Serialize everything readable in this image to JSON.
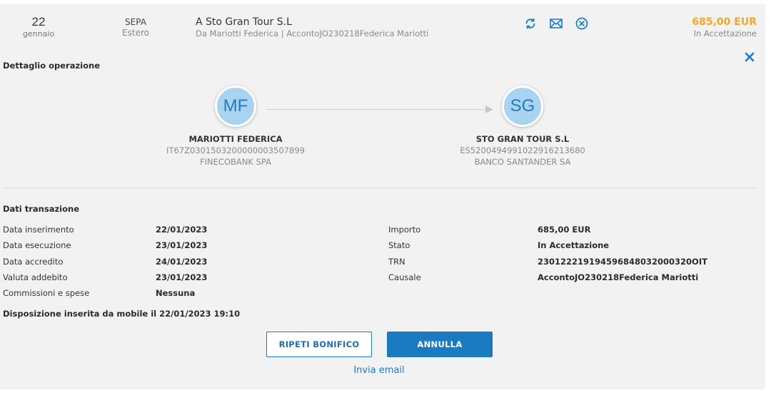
{
  "summary": {
    "day": "22",
    "month": "gennaio",
    "type_line1": "SEPA",
    "type_line2": "Estero",
    "title": "A Sto Gran Tour S.L",
    "subtitle": "Da Mariotti Federica | AccontoJO230218Federica Mariotti",
    "amount": "685,00 EUR",
    "amount_status": "In Accettazione",
    "actions": [
      {
        "icon": "repeat-icon"
      },
      {
        "icon": "mail-icon"
      },
      {
        "icon": "cancel-circle-icon"
      }
    ]
  },
  "detail": {
    "section_title": "Dettaglio operazione",
    "close_icon": "close-icon",
    "sender": {
      "initials": "MF",
      "name": "MARIOTTI FEDERICA",
      "iban": "IT67Z0301503200000003507899",
      "bank": "FINECOBANK SPA"
    },
    "beneficiary": {
      "initials": "SG",
      "name": "STO GRAN TOUR S.L",
      "iban": "ES5200494991022916213680",
      "bank": "BANCO SANTANDER SA"
    }
  },
  "transaction": {
    "section_title": "Dati transazione",
    "left": [
      {
        "label": "Data inserimento",
        "value": "22/01/2023"
      },
      {
        "label": "Data esecuzione",
        "value": "23/01/2023"
      },
      {
        "label": "Data accredito",
        "value": "24/01/2023"
      },
      {
        "label": "Valuta addebito",
        "value": "23/01/2023"
      },
      {
        "label": "Commissioni e spese",
        "value": "Nessuna"
      }
    ],
    "right": [
      {
        "label": "Importo",
        "value": "685,00 EUR"
      },
      {
        "label": "Stato",
        "value": "In Accettazione"
      },
      {
        "label": "TRN",
        "value": "230122219194596848032000320OIT"
      },
      {
        "label": "Causale",
        "value": "AccontoJO230218Federica Mariotti"
      }
    ],
    "note": "Disposizione inserita da mobile il 22/01/2023 19:10"
  },
  "buttons": {
    "repeat_label": "RIPETI BONIFICO",
    "cancel_label": "ANNULLA",
    "email_link": "Invia email"
  },
  "colors": {
    "accent": "#1a7bc0",
    "amount_pending": "#f5a623",
    "avatar_bg": "#a8d4f2"
  }
}
